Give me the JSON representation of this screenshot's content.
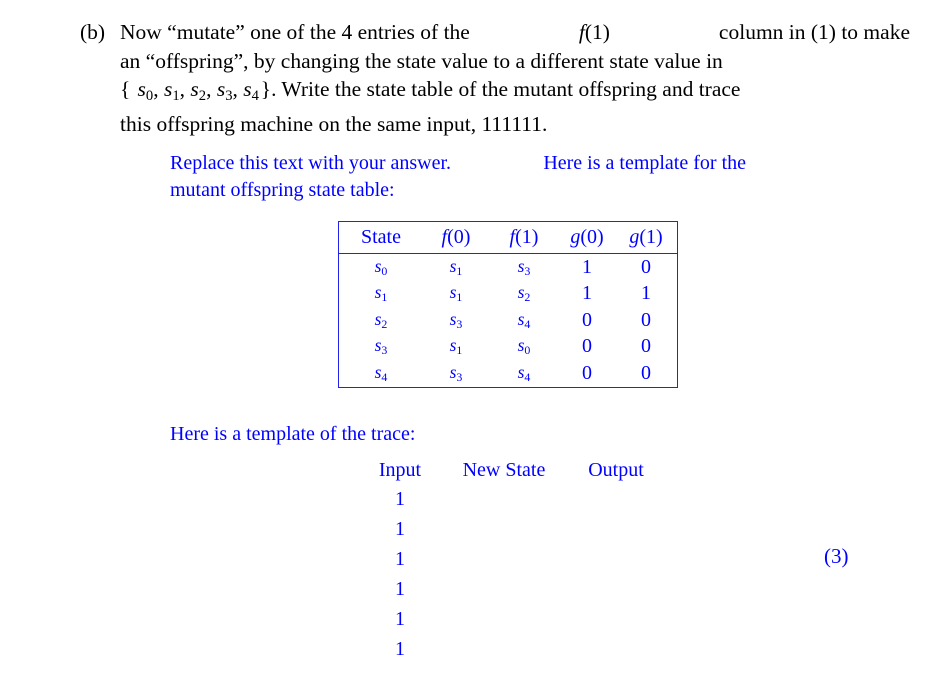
{
  "problem": {
    "label": "(b)",
    "lines": [
      "Now “mutate” one of the 4 entries of the",
      "column in (1) to make",
      "an “offspring”, by changing the state value to a different state value in",
      ". Write the state table of the mutant offspring and trace",
      "this offspring machine on the same input, 111111."
    ],
    "f1_inline": "f(1)",
    "state_set_open": "{",
    "state_set_close": "}",
    "state_set_items": [
      "s0",
      "s1",
      "s2",
      "s3",
      "s4"
    ],
    "input_string": "111111"
  },
  "answer": {
    "intro_line1_left": "Replace this text with your answer.",
    "intro_line1_right": "Here is a template for the",
    "intro_line2": "mutant offspring state table:",
    "trace_intro": "Here is a template of the trace:"
  },
  "state_table": {
    "headers": {
      "state": "State",
      "f0": "f(0)",
      "f1": "f(1)",
      "g0": "g(0)",
      "g1": "g(1)"
    },
    "rows": [
      {
        "state": "s0",
        "f0": "s1",
        "f1": "s3",
        "g0": "1",
        "g1": "0"
      },
      {
        "state": "s1",
        "f0": "s1",
        "f1": "s2",
        "g0": "1",
        "g1": "1"
      },
      {
        "state": "s2",
        "f0": "s3",
        "f1": "s4",
        "g0": "0",
        "g1": "0"
      },
      {
        "state": "s3",
        "f0": "s1",
        "f1": "s0",
        "g0": "0",
        "g1": "0"
      },
      {
        "state": "s4",
        "f0": "s3",
        "f1": "s4",
        "g0": "0",
        "g1": "0"
      }
    ]
  },
  "trace_table": {
    "headers": {
      "input": "Input",
      "new_state": "New State",
      "output": "Output"
    },
    "rows": [
      {
        "input": "1",
        "new_state": "",
        "output": ""
      },
      {
        "input": "1",
        "new_state": "",
        "output": ""
      },
      {
        "input": "1",
        "new_state": "",
        "output": ""
      },
      {
        "input": "1",
        "new_state": "",
        "output": ""
      },
      {
        "input": "1",
        "new_state": "",
        "output": ""
      },
      {
        "input": "1",
        "new_state": "",
        "output": ""
      }
    ]
  },
  "equation_number": "(3)",
  "colors": {
    "body_text": "#000000",
    "answer_text": "#0000ff",
    "table_rule": "#2222ee"
  }
}
